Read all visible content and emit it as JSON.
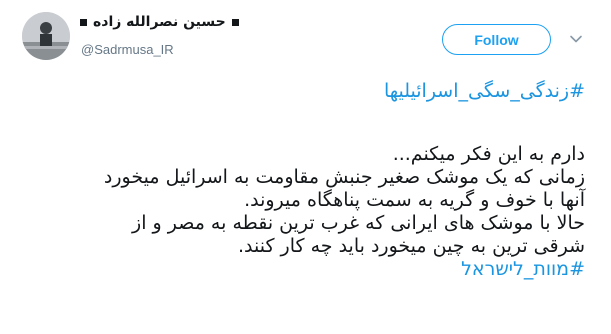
{
  "user": {
    "display_name": "حسین نصرالله زاده",
    "handle": "@Sadrmusa_IR"
  },
  "actions": {
    "follow_label": "Follow"
  },
  "tweet": {
    "hashtag_top": "#زندگی_سگی_اسرائیلیها",
    "lines": [
      "دارم به این فکر میکنم...",
      "زمانی که یک موشک صغیر جنبش مقاومت به اسرائیل میخورد",
      "آنها با خوف و گریه به سمت پناهگاه میروند.",
      "حالا با موشک های ایرانی که غرب ترین نقطه به مصر و از",
      "شرقی ترین به چین میخورد باید چه کار کنند."
    ],
    "hashtag_bottom": "#מוות_לישראל"
  },
  "colors": {
    "accent": "#1da1f2",
    "hashtag": "#1b95e0",
    "text": "#14171a",
    "muted": "#657786"
  },
  "icons": {
    "menu": "chevron-down-icon",
    "avatar": "avatar"
  }
}
